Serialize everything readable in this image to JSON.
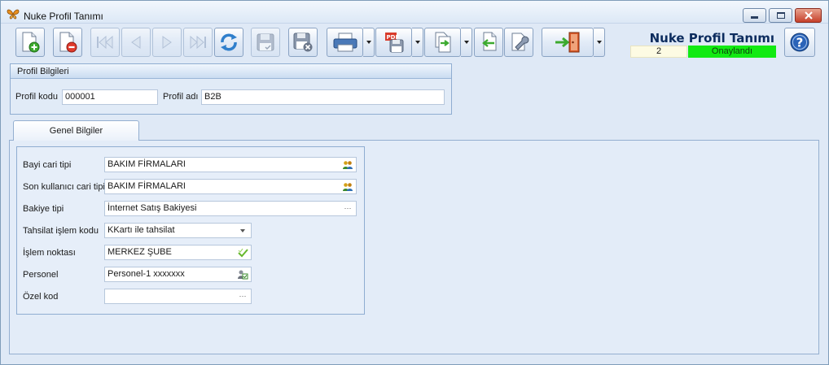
{
  "window": {
    "title": "Nuke Profil Tanımı"
  },
  "toolbar": {
    "buttons": [
      {
        "name": "new-record",
        "icon": "new-doc-icon"
      },
      {
        "name": "delete-record",
        "icon": "delete-doc-icon"
      },
      {
        "name": "first",
        "icon": "first-icon"
      },
      {
        "name": "previous",
        "icon": "previous-icon"
      },
      {
        "name": "next",
        "icon": "next-icon"
      },
      {
        "name": "last",
        "icon": "last-icon"
      },
      {
        "name": "refresh",
        "icon": "refresh-icon"
      },
      {
        "name": "save",
        "icon": "save-icon"
      },
      {
        "name": "save-cancel",
        "icon": "save-cancel-icon"
      },
      {
        "name": "print",
        "icon": "printer-icon"
      },
      {
        "name": "pdf",
        "icon": "pdf-icon"
      },
      {
        "name": "export",
        "icon": "export-icon"
      },
      {
        "name": "import",
        "icon": "import-icon"
      },
      {
        "name": "tools",
        "icon": "wrench-icon"
      },
      {
        "name": "exit",
        "icon": "exit-door-icon"
      }
    ]
  },
  "header": {
    "form_title": "Nuke Profil Tanımı",
    "record_number": "2",
    "status": "Onaylandı",
    "status_color": "#12ea12"
  },
  "profile": {
    "group_title": "Profil Bilgileri",
    "code_label": "Profil kodu",
    "code_value": "000001",
    "name_label": "Profil adı",
    "name_value": "B2B"
  },
  "tabs": [
    {
      "label": "Genel Bilgiler"
    }
  ],
  "general": {
    "fields": [
      {
        "label": "Bayi cari tipi",
        "value": "BAKIM FİRMALARI",
        "icon": "users-icon"
      },
      {
        "label": "Son kullanıcı cari tipi",
        "value": "BAKIM FİRMALARI",
        "icon": "users-icon"
      },
      {
        "label": "Bakiye tipi",
        "value": "İnternet Satış Bakiyesi",
        "icon": "ellipsis-icon"
      },
      {
        "label": "Tahsilat işlem kodu",
        "value": "KKartı ile tahsilat",
        "icon": "dropdown-icon"
      },
      {
        "label": "İşlem noktası",
        "value": "MERKEZ ŞUBE",
        "icon": "check-icon"
      },
      {
        "label": "Personel",
        "value": "Personel-1 xxxxxxx",
        "icon": "person-lookup-icon"
      },
      {
        "label": "Özel kod",
        "value": "",
        "icon": "ellipsis-icon"
      }
    ]
  }
}
